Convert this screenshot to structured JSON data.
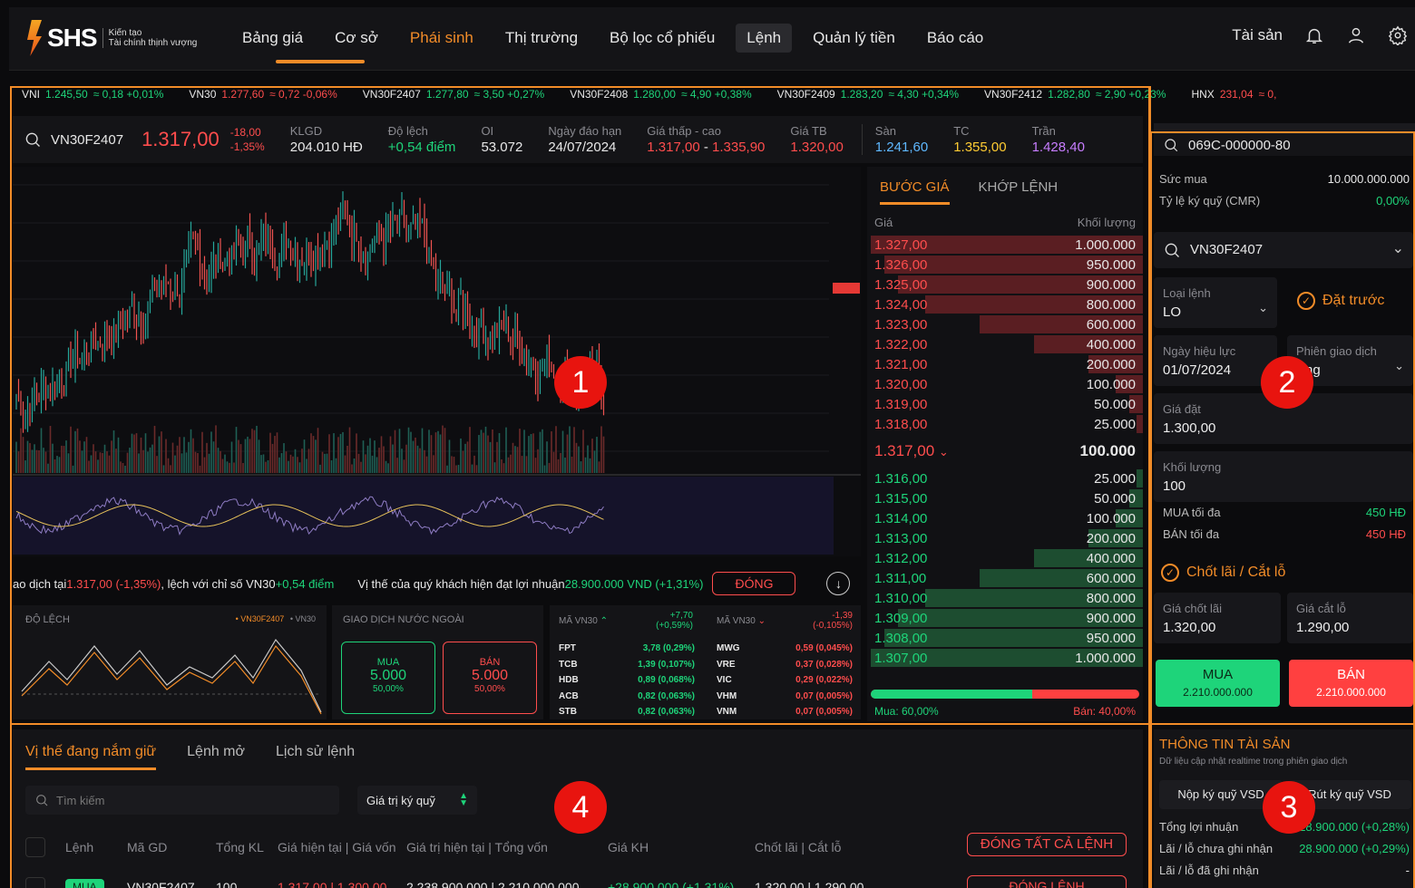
{
  "header": {
    "brand": "SHS",
    "tagline_1": "Kiến tạo",
    "tagline_2": "Tài chính thịnh vượng",
    "nav": [
      "Bảng giá",
      "Cơ sở",
      "Phái sinh",
      "Thị trường",
      "Bộ lọc cổ phiếu",
      "Lệnh",
      "Quản lý tiền",
      "Báo cáo"
    ],
    "assets_label": "Tài sản",
    "icons": [
      "bell-icon",
      "user-icon",
      "gear-icon"
    ]
  },
  "ticker": [
    {
      "name": "VNI",
      "value": "1.245,50",
      "change": "≈ 0,18 +0,01%",
      "color": "green"
    },
    {
      "name": "VN30",
      "value": "1.277,60",
      "change": "≈ 0,72 -0,06%",
      "color": "red"
    },
    {
      "name": "VN30F2407",
      "value": "1.277,80",
      "change": "≈ 3,50 +0,27%",
      "color": "green"
    },
    {
      "name": "VN30F2408",
      "value": "1.280,00",
      "change": "≈ 4,90 +0,38%",
      "color": "green"
    },
    {
      "name": "VN30F2409",
      "value": "1.283,20",
      "change": "≈ 4,30 +0,34%",
      "color": "green"
    },
    {
      "name": "VN30F2412",
      "value": "1.282,80",
      "change": "≈ 2,90 +0,23%",
      "color": "green"
    },
    {
      "name": "HNX",
      "value": "231,04",
      "change": "≈ 0,",
      "color": "red"
    }
  ],
  "instrument": {
    "symbol": "VN30F2407",
    "price": "1.317,00",
    "change": "-18,00",
    "change_pct": "-1,35%",
    "klgd_label": "KLGD",
    "klgd": "204.010 HĐ",
    "dolech_label": "Độ lệch",
    "dolech": "+0,54 điểm",
    "oi_label": "OI",
    "oi": "53.072",
    "expiry_label": "Ngày đáo hạn",
    "expiry": "24/07/2024",
    "range_label": "Giá thấp - cao",
    "low": "1.317,00",
    "high": "1.335,90",
    "avg_label": "Giá TB",
    "avg": "1.320,00",
    "floor_label": "Sàn",
    "floor": "1.241,60",
    "ref_label": "TC",
    "ref": "1.355,00",
    "ceil_label": "Trần",
    "ceil": "1.428,40"
  },
  "orderbook": {
    "tab_active": "BƯỚC GIÁ",
    "tab_other": "KHỚP LỆNH",
    "col_price": "Giá",
    "col_volume": "Khối lượng",
    "asks": [
      {
        "p": "1.327,00",
        "v": "1.000.000",
        "f": 1.0
      },
      {
        "p": "1.326,00",
        "v": "950.000",
        "f": 0.95
      },
      {
        "p": "1.325,00",
        "v": "900.000",
        "f": 0.9
      },
      {
        "p": "1.324,00",
        "v": "800.000",
        "f": 0.8
      },
      {
        "p": "1.323,00",
        "v": "600.000",
        "f": 0.6
      },
      {
        "p": "1.322,00",
        "v": "400.000",
        "f": 0.4
      },
      {
        "p": "1.321,00",
        "v": "200.000",
        "f": 0.2
      },
      {
        "p": "1.320,00",
        "v": "100.000",
        "f": 0.1
      },
      {
        "p": "1.319,00",
        "v": "50.000",
        "f": 0.05
      },
      {
        "p": "1.318,00",
        "v": "25.000",
        "f": 0.025
      }
    ],
    "last_price": "1.317,00",
    "last_volume": "100.000",
    "bids": [
      {
        "p": "1.316,00",
        "v": "25.000",
        "f": 0.025
      },
      {
        "p": "1.315,00",
        "v": "50.000",
        "f": 0.05
      },
      {
        "p": "1.314,00",
        "v": "100.000",
        "f": 0.1
      },
      {
        "p": "1.313,00",
        "v": "200.000",
        "f": 0.2
      },
      {
        "p": "1.312,00",
        "v": "400.000",
        "f": 0.4
      },
      {
        "p": "1.311,00",
        "v": "600.000",
        "f": 0.6
      },
      {
        "p": "1.310,00",
        "v": "800.000",
        "f": 0.8
      },
      {
        "p": "1.309,00",
        "v": "900.000",
        "f": 0.9
      },
      {
        "p": "1.308,00",
        "v": "950.000",
        "f": 0.95
      },
      {
        "p": "1.307,00",
        "v": "1.000.000",
        "f": 1.0
      }
    ],
    "buy_ratio": 0.6,
    "buy_label": "Mua: 60,00%",
    "sell_label": "Bán: 40,00%"
  },
  "strip": {
    "text_a": "ao dịch tại ",
    "price": "1.317,00 (-1,35%)",
    "text_b": ", lệch với chỉ số VN30 ",
    "deviation": "+0,54 điểm",
    "text_c": "Vị thế của quý khách hiện đạt lợi nhuận ",
    "profit": "28.900.000 VND (+1,31%)",
    "close_btn": "ĐÓNG"
  },
  "mini": {
    "dolech_title": "ĐỘ LỆCH",
    "legend_a": "• VN30F2407",
    "legend_b": "• VN30",
    "foreign_title": "GIAO DỊCH NƯỚC NGOÀI",
    "buy_label": "MUA",
    "buy_value": "5.000",
    "buy_pct": "50,00%",
    "sell_label": "BÁN",
    "sell_value": "5.000",
    "sell_pct": "50,00%",
    "up_title": "MÃ VN30",
    "up_change": "+7,70",
    "up_pct": "(+0,59%)",
    "down_title": "MÃ VN30",
    "down_change": "-1,39",
    "down_pct": "(-0,105%)",
    "up_list": [
      [
        "FPT",
        "3,78 (0,29%)"
      ],
      [
        "TCB",
        "1,39 (0,107%)"
      ],
      [
        "HDB",
        "0,89 (0,068%)"
      ],
      [
        "ACB",
        "0,82 (0,063%)"
      ],
      [
        "STB",
        "0,82 (0,063%)"
      ]
    ],
    "down_list": [
      [
        "MWG",
        "0,59 (0,045%)"
      ],
      [
        "VRE",
        "0,37 (0,028%)"
      ],
      [
        "VIC",
        "0,29 (0,022%)"
      ],
      [
        "VHM",
        "0,07 (0,005%)"
      ],
      [
        "VNM",
        "0,07 (0,005%)"
      ]
    ]
  },
  "order_form": {
    "account": "069C-000000-80",
    "purchasing_power_label": "Sức mua",
    "purchasing_power": "10.000.000.000",
    "cmr_label": "Tỷ lệ ký quỹ (CMR)",
    "cmr": "0,00%",
    "symbol": "VN30F2407",
    "order_type_label": "Loại lệnh",
    "order_type": "LO",
    "advance_label": "Đặt trước",
    "valid_date_label": "Ngày hiệu lực",
    "valid_date": "01/07/2024",
    "session_label": "Phiên giao dịch",
    "session": "ứng",
    "price_label": "Giá đặt",
    "price": "1.300,00",
    "qty_label": "Khối lượng",
    "qty": "100",
    "max_buy_label": "MUA tối đa",
    "max_buy": "450 HĐ",
    "max_sell_label": "BÁN tối đa",
    "max_sell": "450 HĐ",
    "tpsl_label": "Chốt lãi / Cắt lỗ",
    "tp_label": "Giá chốt lãi",
    "tp": "1.320,00",
    "sl_label": "Giá cắt lỗ",
    "sl": "1.290,00",
    "buy_btn": "MUA",
    "buy_amount": "2.210.000.000",
    "sell_btn": "BÁN",
    "sell_amount": "2.210.000.000"
  },
  "positions": {
    "tabs": [
      "Vị thế đang nắm giữ",
      "Lệnh mở",
      "Lịch sử lệnh"
    ],
    "search_placeholder": "Tìm kiếm",
    "sort_label": "Giá trị ký quỹ",
    "columns": [
      "Lệnh",
      "Mã GD",
      "Tổng KL",
      "Giá hiện tại | Giá vốn",
      "Giá trị hiện tại | Tổng vốn",
      "Giá KH",
      "Chốt lãi | Cắt lỗ"
    ],
    "close_all": "ĐÓNG TẤT CẢ LỆNH",
    "row": {
      "side": "MUA",
      "symbol": "VN30F2407",
      "qty": "100",
      "price": "1.317,00 | 1.300,00",
      "value": "2.238.900.000 | 2.210.000.000",
      "pnl": "+28.900.000 (+1,31%)",
      "tpsl": "1.320,00 | 1.290,00",
      "close": "ĐÓNG LỆNH"
    }
  },
  "assets": {
    "title": "THÔNG TIN TÀI SẢN",
    "subtitle": "Dữ liệu cập nhật realtime trong phiên giao dịch",
    "deposit_btn": "Nộp ký quỹ VSD",
    "withdraw_btn": "Rút ký quỹ VSD",
    "total_pnl_label": "Tổng lợi nhuận",
    "total_pnl": "28.900.000 (+0,28%)",
    "unrealized_label": "Lãi / lỗ chưa ghi nhận",
    "unrealized": "28.900.000 (+0,29%)",
    "realized_label": "Lãi / lỗ đã ghi nhận",
    "realized": "-"
  },
  "annotations": [
    "1",
    "2",
    "3",
    "4"
  ],
  "colors": {
    "accent": "#f28c28",
    "up": "#1ed47a",
    "down": "#ff4d4d",
    "ref": "#ffcc33",
    "ceil": "#c77dff",
    "floor": "#5fb8ff"
  }
}
